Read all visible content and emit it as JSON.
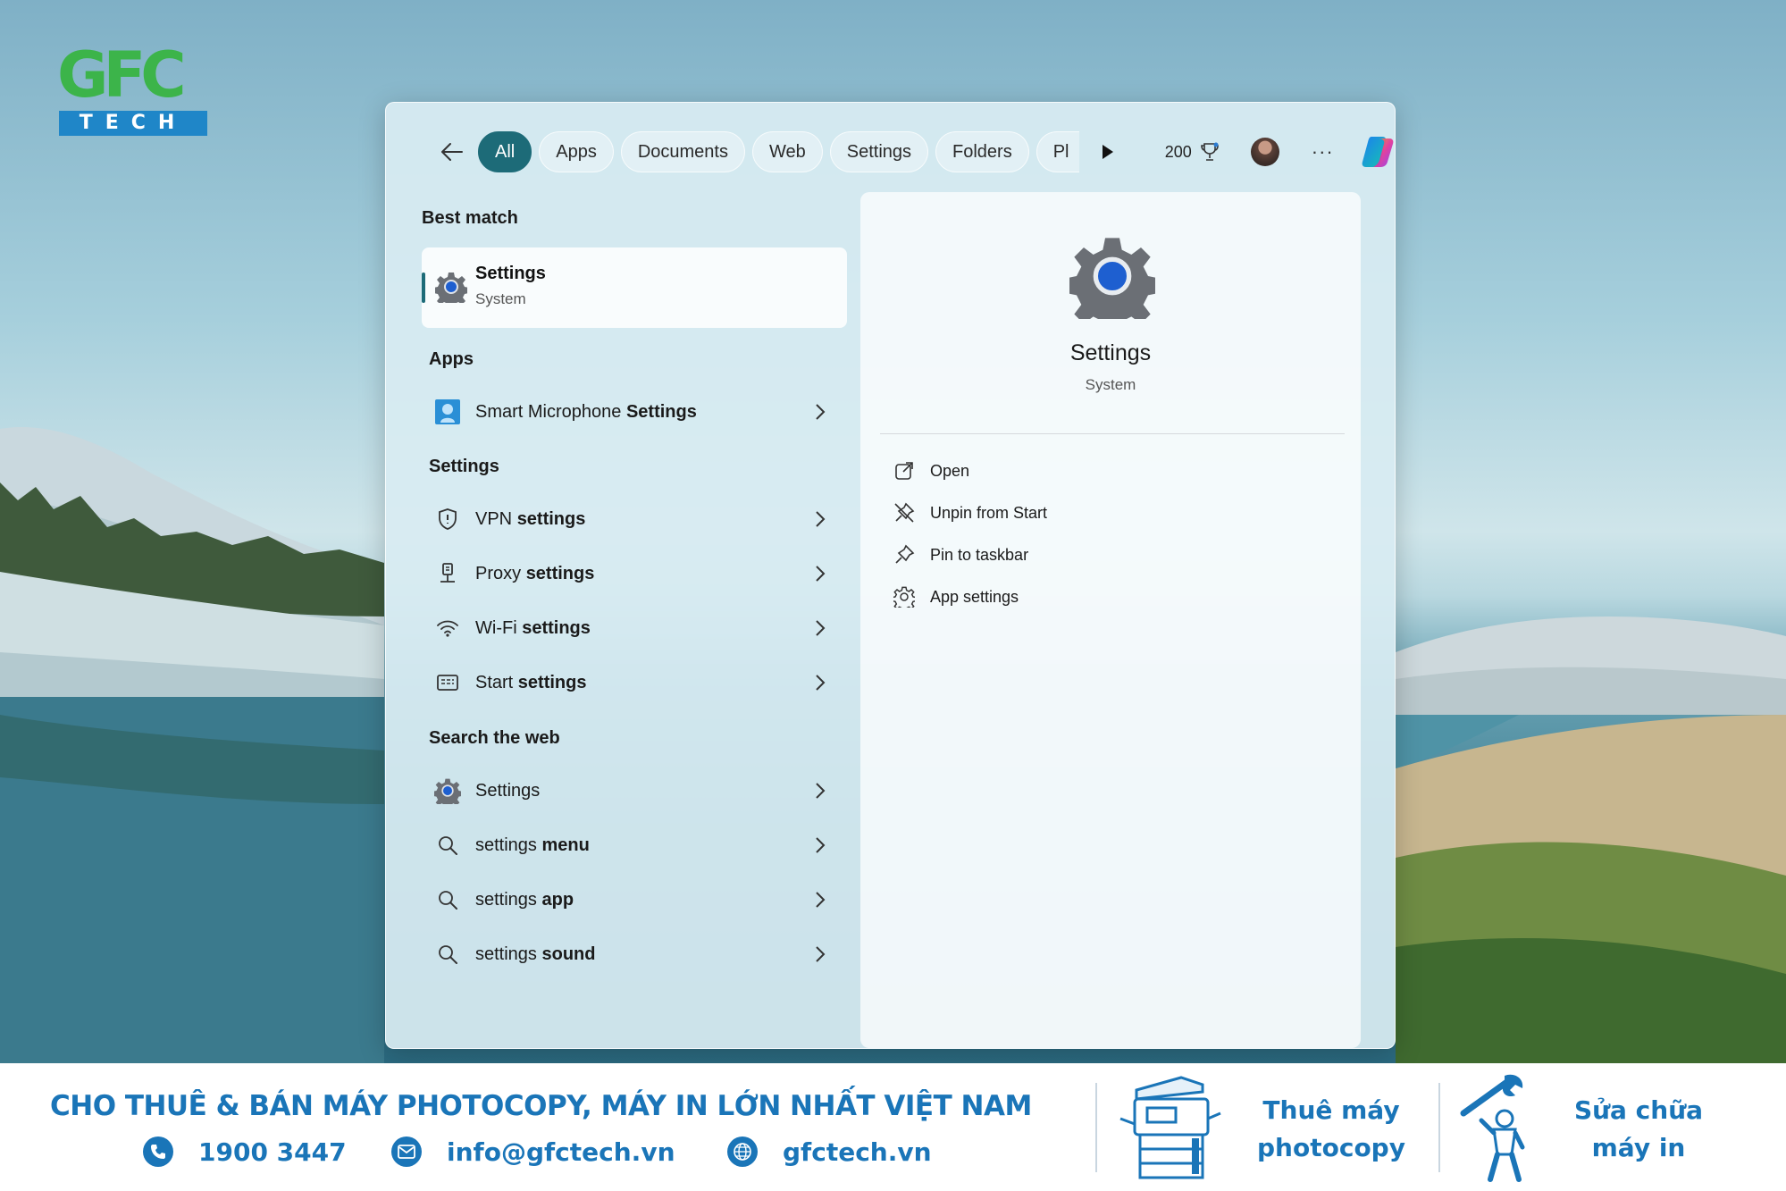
{
  "logo": {
    "top_text": "GFC",
    "bottom_text": "TECH"
  },
  "search": {
    "filters": [
      "All",
      "Apps",
      "Documents",
      "Web",
      "Settings",
      "Folders",
      "Pl"
    ],
    "active_filter": "All",
    "points": "200"
  },
  "results": {
    "best_match": {
      "heading": "Best match",
      "title": "Settings",
      "subtitle": "System"
    },
    "apps": {
      "heading": "Apps",
      "items": [
        {
          "plain": "Smart Microphone ",
          "bold": "Settings"
        }
      ]
    },
    "settings": {
      "heading": "Settings",
      "items": [
        {
          "plain": "VPN ",
          "bold": "settings",
          "icon": "shield-icon"
        },
        {
          "plain": "Proxy ",
          "bold": "settings",
          "icon": "proxy-icon"
        },
        {
          "plain": "Wi-Fi ",
          "bold": "settings",
          "icon": "wifi-icon"
        },
        {
          "plain": "Start ",
          "bold": "settings",
          "icon": "start-menu-icon"
        }
      ]
    },
    "web": {
      "heading": "Search the web",
      "items": [
        {
          "plain": "Settings",
          "bold": "",
          "icon": "settings-gear-icon"
        },
        {
          "plain": "settings ",
          "bold": "menu",
          "icon": "search-icon"
        },
        {
          "plain": "settings ",
          "bold": "app",
          "icon": "search-icon"
        },
        {
          "plain": "settings ",
          "bold": "sound",
          "icon": "search-icon"
        }
      ]
    }
  },
  "preview": {
    "title": "Settings",
    "subtitle": "System",
    "actions": [
      {
        "label": "Open",
        "icon": "open-external-icon"
      },
      {
        "label": "Unpin from Start",
        "icon": "unpin-icon"
      },
      {
        "label": "Pin to taskbar",
        "icon": "pin-icon"
      },
      {
        "label": "App settings",
        "icon": "gear-outline-icon"
      }
    ]
  },
  "banner": {
    "headline": "CHO THUÊ & BÁN MÁY PHOTOCOPY, MÁY IN LỚN NHẤT VIỆT NAM",
    "phone": "1900 3447",
    "email": "info@gfctech.vn",
    "website": "gfctech.vn",
    "service1_line1": "Thuê máy",
    "service1_line2": "photocopy",
    "service2_line1": "Sửa chữa",
    "service2_line2": "máy in",
    "brand_color": "#1a75b8"
  }
}
